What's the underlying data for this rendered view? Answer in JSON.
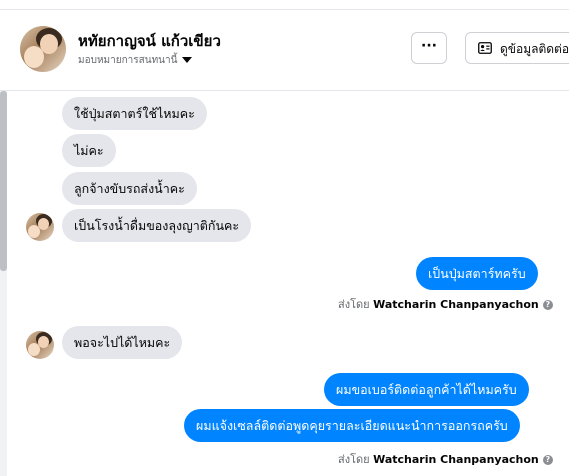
{
  "header": {
    "name": "หทัยกาญจน์ แก้วเขียว",
    "assign_label": "มอบหมายการสนทนานี้",
    "more_label": "···",
    "contact_label": "ดูข้อมูลติดต่อ"
  },
  "messages": {
    "in1": "ใช้ปุ่มสตาตร์ใช้ไหมคะ",
    "in2": "ไม่คะ",
    "in3": "ลูกจ้างขับรถส่งน้ำคะ",
    "in4": "เป็นโรงน้ำดื่มของลุงญาติกันคะ",
    "out1": "เป็นปุ่มสตาร์ทครับ",
    "sentby1_prefix": "ส่งโดย",
    "sentby1_name": "Watcharin Chanpanyachon",
    "in5": "พอจะไปได้ไหมคะ",
    "out2": "ผมขอเบอร์ติดต่อลูกค้าได้ไหมครับ",
    "out3": "ผมแจ้งเซลล์ติดต่อพูดคุยรายละเอียดแนะนำการออกรถครับ",
    "sentby2_prefix": "ส่งโดย",
    "sentby2_name": "Watcharin Chanpanyachon"
  },
  "colors": {
    "outgoing_bubble": "#0084ff",
    "incoming_bubble": "#e4e6eb"
  },
  "icons": {
    "more": "more-dots-icon",
    "contact": "contact-card-icon",
    "info": "info-icon",
    "caret": "caret-down-icon"
  }
}
